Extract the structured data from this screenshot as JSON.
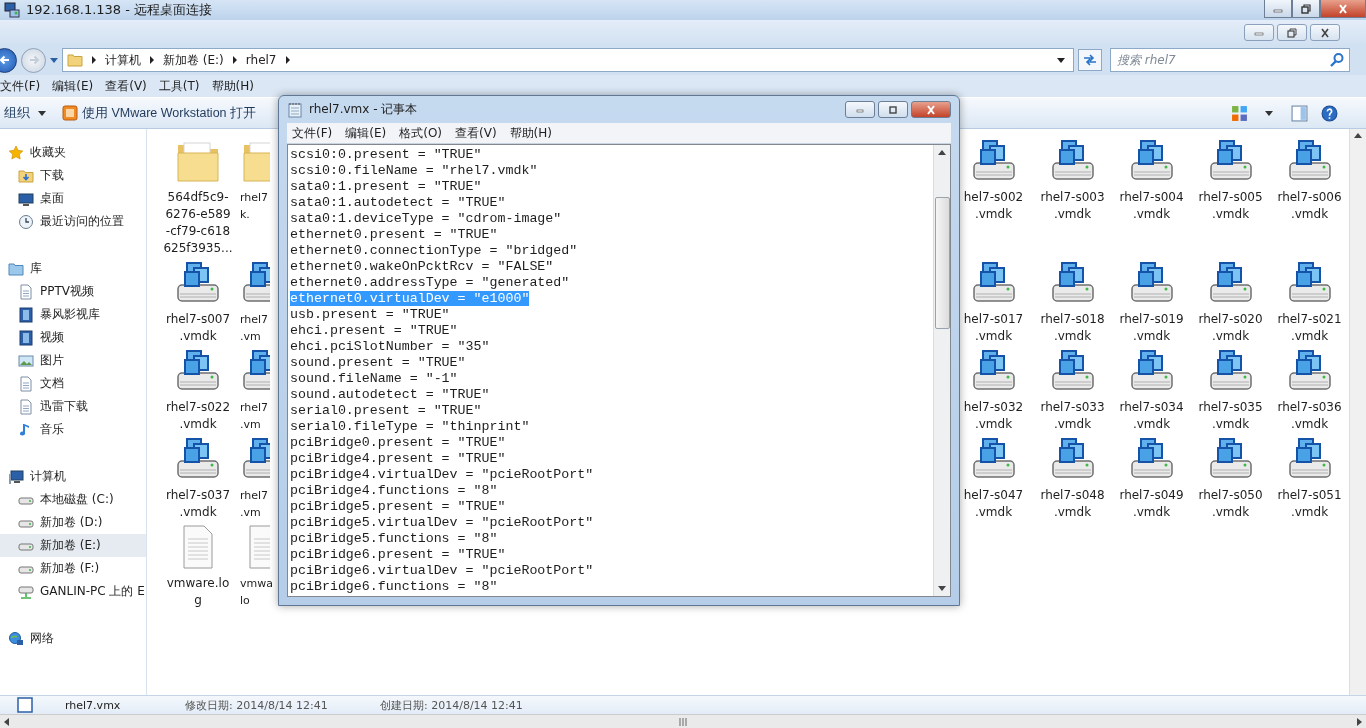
{
  "remote_window": {
    "title": "192.168.1.138 - 远程桌面连接"
  },
  "explorer": {
    "breadcrumb": [
      "计算机",
      "新加卷 (E:)",
      "rhel7"
    ],
    "search": {
      "placeholder": "搜索 rhel7"
    },
    "menu": [
      "文件(F)",
      "编辑(E)",
      "查看(V)",
      "工具(T)",
      "帮助(H)"
    ],
    "toolbar": {
      "organize": "组织",
      "open_with": "使用 VMware Workstation 打开"
    },
    "sidebar": [
      {
        "label": "收藏夹",
        "kind": "star",
        "selected": false,
        "children": [
          {
            "label": "下载",
            "kind": "folder",
            "selected": false
          },
          {
            "label": "桌面",
            "kind": "monitor",
            "selected": false
          },
          {
            "label": "最近访问的位置",
            "kind": "recent",
            "selected": false
          }
        ]
      },
      {
        "label": "库",
        "kind": "library",
        "selected": false,
        "children": [
          {
            "label": "PPTV视频",
            "kind": "document",
            "selected": false
          },
          {
            "label": "暴风影视库",
            "kind": "film",
            "selected": false
          },
          {
            "label": "视频",
            "kind": "film",
            "selected": false
          },
          {
            "label": "图片",
            "kind": "picture",
            "selected": false
          },
          {
            "label": "文档",
            "kind": "document",
            "selected": false
          },
          {
            "label": "迅雷下载",
            "kind": "document",
            "selected": false
          },
          {
            "label": "音乐",
            "kind": "music",
            "selected": false
          }
        ]
      },
      {
        "label": "计算机",
        "kind": "computer",
        "selected": false,
        "children": [
          {
            "label": "本地磁盘 (C:)",
            "kind": "drive",
            "selected": false
          },
          {
            "label": "新加卷 (D:)",
            "kind": "drive",
            "selected": false
          },
          {
            "label": "新加卷 (E:)",
            "kind": "drive",
            "selected": true
          },
          {
            "label": "新加卷 (F:)",
            "kind": "drive",
            "selected": false
          },
          {
            "label": "GANLIN-PC 上的 E",
            "kind": "network-drive",
            "selected": false
          }
        ]
      },
      {
        "label": "网络",
        "kind": "network",
        "selected": false
      }
    ],
    "file_rows": [
      {
        "left": [
          {
            "kind": "folder",
            "lines": [
              "564df5c9-",
              "6276-e589",
              "-cf79-c618",
              "625f3935..."
            ]
          },
          {
            "kind": "folder",
            "lines": [
              "rhel7",
              "k."
            ]
          }
        ],
        "right": [
          {
            "kind": "vmdk",
            "lines": [
              "hel7-s002",
              ".vmdk"
            ]
          },
          {
            "kind": "vmdk",
            "lines": [
              "rhel7-s003",
              ".vmdk"
            ]
          },
          {
            "kind": "vmdk",
            "lines": [
              "rhel7-s004",
              ".vmdk"
            ]
          },
          {
            "kind": "vmdk",
            "lines": [
              "rhel7-s005",
              ".vmdk"
            ]
          },
          {
            "kind": "vmdk",
            "lines": [
              "rhel7-s006",
              ".vmdk"
            ]
          }
        ]
      },
      {
        "left": [
          {
            "kind": "vmdk",
            "lines": [
              "rhel7-s007",
              ".vmdk"
            ]
          },
          {
            "kind": "vmdk",
            "lines": [
              "rhel7",
              ".vm"
            ]
          }
        ],
        "right": [
          {
            "kind": "vmdk",
            "lines": [
              "hel7-s017",
              ".vmdk"
            ]
          },
          {
            "kind": "vmdk",
            "lines": [
              "rhel7-s018",
              ".vmdk"
            ]
          },
          {
            "kind": "vmdk",
            "lines": [
              "rhel7-s019",
              ".vmdk"
            ]
          },
          {
            "kind": "vmdk",
            "lines": [
              "rhel7-s020",
              ".vmdk"
            ]
          },
          {
            "kind": "vmdk",
            "lines": [
              "rhel7-s021",
              ".vmdk"
            ]
          }
        ]
      },
      {
        "left": [
          {
            "kind": "vmdk",
            "lines": [
              "rhel7-s022",
              ".vmdk"
            ]
          },
          {
            "kind": "vmdk",
            "lines": [
              "rhel7",
              ".vm"
            ]
          }
        ],
        "right": [
          {
            "kind": "vmdk",
            "lines": [
              "hel7-s032",
              ".vmdk"
            ]
          },
          {
            "kind": "vmdk",
            "lines": [
              "rhel7-s033",
              ".vmdk"
            ]
          },
          {
            "kind": "vmdk",
            "lines": [
              "rhel7-s034",
              ".vmdk"
            ]
          },
          {
            "kind": "vmdk",
            "lines": [
              "rhel7-s035",
              ".vmdk"
            ]
          },
          {
            "kind": "vmdk",
            "lines": [
              "rhel7-s036",
              ".vmdk"
            ]
          }
        ]
      },
      {
        "left": [
          {
            "kind": "vmdk",
            "lines": [
              "rhel7-s037",
              ".vmdk"
            ]
          },
          {
            "kind": "vmdk",
            "lines": [
              "rhel7",
              ".vm"
            ]
          }
        ],
        "right": [
          {
            "kind": "vmdk",
            "lines": [
              "hel7-s047",
              ".vmdk"
            ]
          },
          {
            "kind": "vmdk",
            "lines": [
              "rhel7-s048",
              ".vmdk"
            ]
          },
          {
            "kind": "vmdk",
            "lines": [
              "rhel7-s049",
              ".vmdk"
            ]
          },
          {
            "kind": "vmdk",
            "lines": [
              "rhel7-s050",
              ".vmdk"
            ]
          },
          {
            "kind": "vmdk",
            "lines": [
              "rhel7-s051",
              ".vmdk"
            ]
          }
        ]
      },
      {
        "left": [
          {
            "kind": "log",
            "lines": [
              "vmware.lo",
              "g"
            ]
          },
          {
            "kind": "log",
            "lines": [
              "vmwa",
              "lo"
            ]
          }
        ],
        "right": []
      }
    ],
    "details": {
      "name": "rhel7.vmx",
      "modified": "修改日期: 2014/8/14 12:41",
      "created": "创建日期: 2014/8/14 12:41"
    }
  },
  "notepad": {
    "title": "rhel7.vmx - 记事本",
    "menu": [
      "文件(F)",
      "编辑(E)",
      "格式(O)",
      "查看(V)",
      "帮助(H)"
    ],
    "lines": [
      {
        "text": "scsi0:0.present = \"TRUE\"",
        "selected": false
      },
      {
        "text": "scsi0:0.fileName = \"rhel7.vmdk\"",
        "selected": false
      },
      {
        "text": "sata0:1.present = \"TRUE\"",
        "selected": false
      },
      {
        "text": "sata0:1.autodetect = \"TRUE\"",
        "selected": false
      },
      {
        "text": "sata0:1.deviceType = \"cdrom-image\"",
        "selected": false
      },
      {
        "text": "ethernet0.present = \"TRUE\"",
        "selected": false
      },
      {
        "text": "ethernet0.connectionType = \"bridged\"",
        "selected": false
      },
      {
        "text": "ethernet0.wakeOnPcktRcv = \"FALSE\"",
        "selected": false
      },
      {
        "text": "ethernet0.addressType = \"generated\"",
        "selected": false
      },
      {
        "text": "ethernet0.virtualDev = \"e1000\"",
        "selected": true
      },
      {
        "text": "usb.present = \"TRUE\"",
        "selected": false
      },
      {
        "text": "ehci.present = \"TRUE\"",
        "selected": false
      },
      {
        "text": "ehci.pciSlotNumber = \"35\"",
        "selected": false
      },
      {
        "text": "sound.present = \"TRUE\"",
        "selected": false
      },
      {
        "text": "sound.fileName = \"-1\"",
        "selected": false
      },
      {
        "text": "sound.autodetect = \"TRUE\"",
        "selected": false
      },
      {
        "text": "serial0.present = \"TRUE\"",
        "selected": false
      },
      {
        "text": "serial0.fileType = \"thinprint\"",
        "selected": false
      },
      {
        "text": "pciBridge0.present = \"TRUE\"",
        "selected": false
      },
      {
        "text": "pciBridge4.present = \"TRUE\"",
        "selected": false
      },
      {
        "text": "pciBridge4.virtualDev = \"pcieRootPort\"",
        "selected": false
      },
      {
        "text": "pciBridge4.functions = \"8\"",
        "selected": false
      },
      {
        "text": "pciBridge5.present = \"TRUE\"",
        "selected": false
      },
      {
        "text": "pciBridge5.virtualDev = \"pcieRootPort\"",
        "selected": false
      },
      {
        "text": "pciBridge5.functions = \"8\"",
        "selected": false
      },
      {
        "text": "pciBridge6.present = \"TRUE\"",
        "selected": false
      },
      {
        "text": "pciBridge6.virtualDev = \"pcieRootPort\"",
        "selected": false
      },
      {
        "text": "pciBridge6.functions = \"8\"",
        "selected": false
      }
    ]
  }
}
